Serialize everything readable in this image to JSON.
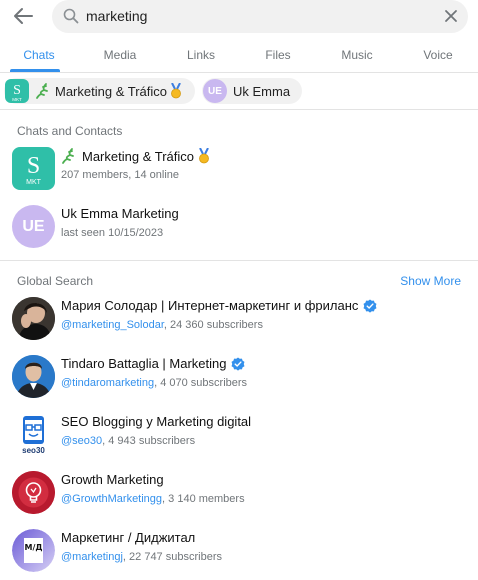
{
  "search": {
    "query": "marketing"
  },
  "tabs": [
    {
      "label": "Chats",
      "active": true
    },
    {
      "label": "Media",
      "active": false
    },
    {
      "label": "Links",
      "active": false
    },
    {
      "label": "Files",
      "active": false
    },
    {
      "label": "Music",
      "active": false
    },
    {
      "label": "Voice",
      "active": false
    }
  ],
  "chips": [
    {
      "label": "Marketing & Tráfico",
      "avatar_text": "S",
      "avatar_subtext": "MKT"
    },
    {
      "label": "Uk Emma",
      "avatar_text": "UE"
    }
  ],
  "chats_section": {
    "title": "Chats and Contacts",
    "items": [
      {
        "title": "Marketing & Tráfico",
        "subtitle": "207 members, 14 online",
        "avatar_text": "S",
        "avatar_subtext": "MKT"
      },
      {
        "title": "Uk Emma Marketing",
        "subtitle": "last seen 10/15/2023",
        "avatar_text": "UE"
      }
    ]
  },
  "global_section": {
    "title": "Global Search",
    "show_more": "Show More",
    "items": [
      {
        "title": "Мария Солодар | Интернет-маркетинг и фриланс",
        "verified": true,
        "handle": "@marketing_Solodar",
        "detail": ", 24 360 subscribers"
      },
      {
        "title": "Tindaro Battaglia | Marketing",
        "verified": true,
        "handle": "@tindaromarketing",
        "detail": ", 4 070 subscribers"
      },
      {
        "title": "SEO Blogging y Marketing digital",
        "verified": false,
        "handle": "@seo30",
        "detail": ", 4 943 subscribers",
        "avatar_text": "seo30"
      },
      {
        "title": "Growth Marketing",
        "verified": false,
        "handle": "@GrowthMarketingg",
        "detail": ", 3 140 members"
      },
      {
        "title": "Маркетинг / Диджитал",
        "verified": false,
        "handle": "@marketingj",
        "detail": ", 22 747 subscribers",
        "avatar_text": "М/Д"
      }
    ]
  },
  "colors": {
    "accent": "#3390ec",
    "secondary_text": "#707579",
    "ue_avatar": "#c9b8f0",
    "mkt_avatar": "#2fbfa8"
  },
  "icons": {
    "back": "arrow-left-icon",
    "search": "search-icon",
    "clear": "close-icon",
    "lizard": "lizard-emoji-icon",
    "medal": "medal-emoji-icon",
    "verified": "verified-badge-icon"
  }
}
